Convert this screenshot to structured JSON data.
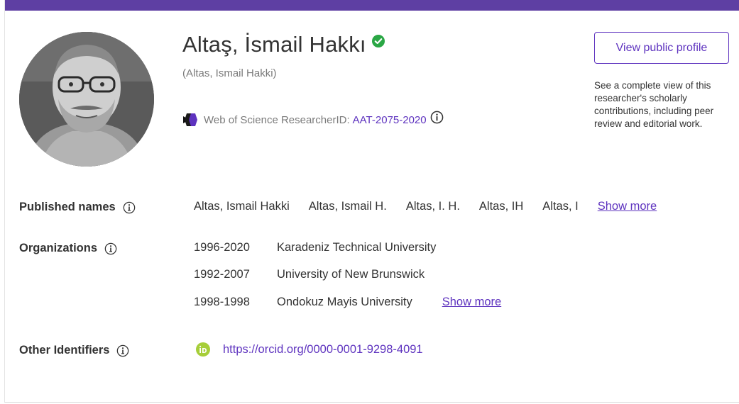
{
  "profile": {
    "name": "Altaş, İsmail Hakkı",
    "alt_name": "(Altas, Ismail Hakki)",
    "researcher_id_label": "Web of Science ResearcherID:",
    "researcher_id": "AAT-2075-2020",
    "verified_icon": "check-circle-icon",
    "avatar_icon": "person-photo"
  },
  "public_profile": {
    "button_label": "View public profile",
    "description": "See a complete view of this researcher's scholarly contributions, including peer review and editorial work."
  },
  "published_names": {
    "label": "Published names",
    "names": [
      "Altas, Ismail Hakki",
      "Altas, Ismail H.",
      "Altas, I. H.",
      "Altas, IH",
      "Altas, I"
    ],
    "show_more": "Show more"
  },
  "organizations": {
    "label": "Organizations",
    "items": [
      {
        "years": "1996-2020",
        "name": "Karadeniz Technical University"
      },
      {
        "years": "1992-2007",
        "name": "University of New Brunswick"
      },
      {
        "years": "1998-1998",
        "name": "Ondokuz Mayis University"
      }
    ],
    "show_more": "Show more"
  },
  "other_identifiers": {
    "label": "Other Identifiers",
    "orcid_url": "https://orcid.org/0000-0001-9298-4091"
  },
  "colors": {
    "brand_purple": "#5e3fa3",
    "link_purple": "#5e33bf",
    "verified_green": "#2aa745",
    "orcid_green": "#a6ce39"
  }
}
